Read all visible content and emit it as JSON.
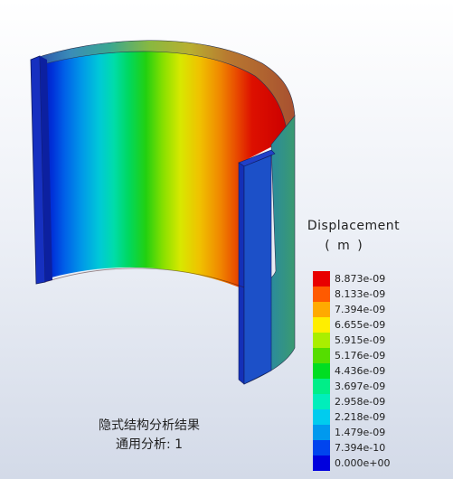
{
  "legend": {
    "title": "Displacement",
    "unit": "( m )",
    "entries": [
      {
        "label": "8.873e-09",
        "color": "#e80000"
      },
      {
        "label": "8.133e-09",
        "color": "#ff5a00"
      },
      {
        "label": "7.394e-09",
        "color": "#ffaa00"
      },
      {
        "label": "6.655e-09",
        "color": "#ffee00"
      },
      {
        "label": "5.915e-09",
        "color": "#aaee00"
      },
      {
        "label": "5.176e-09",
        "color": "#55dd00"
      },
      {
        "label": "4.436e-09",
        "color": "#00dd22"
      },
      {
        "label": "3.697e-09",
        "color": "#00ee88"
      },
      {
        "label": "2.958e-09",
        "color": "#00eebb"
      },
      {
        "label": "2.218e-09",
        "color": "#00ccee"
      },
      {
        "label": "1.479e-09",
        "color": "#0099ee"
      },
      {
        "label": "7.394e-10",
        "color": "#0044ee"
      },
      {
        "label": "0.000e+00",
        "color": "#0000dd"
      }
    ]
  },
  "caption": {
    "line1": "隐式结构分析结果",
    "line2": "通用分析: 1"
  }
}
